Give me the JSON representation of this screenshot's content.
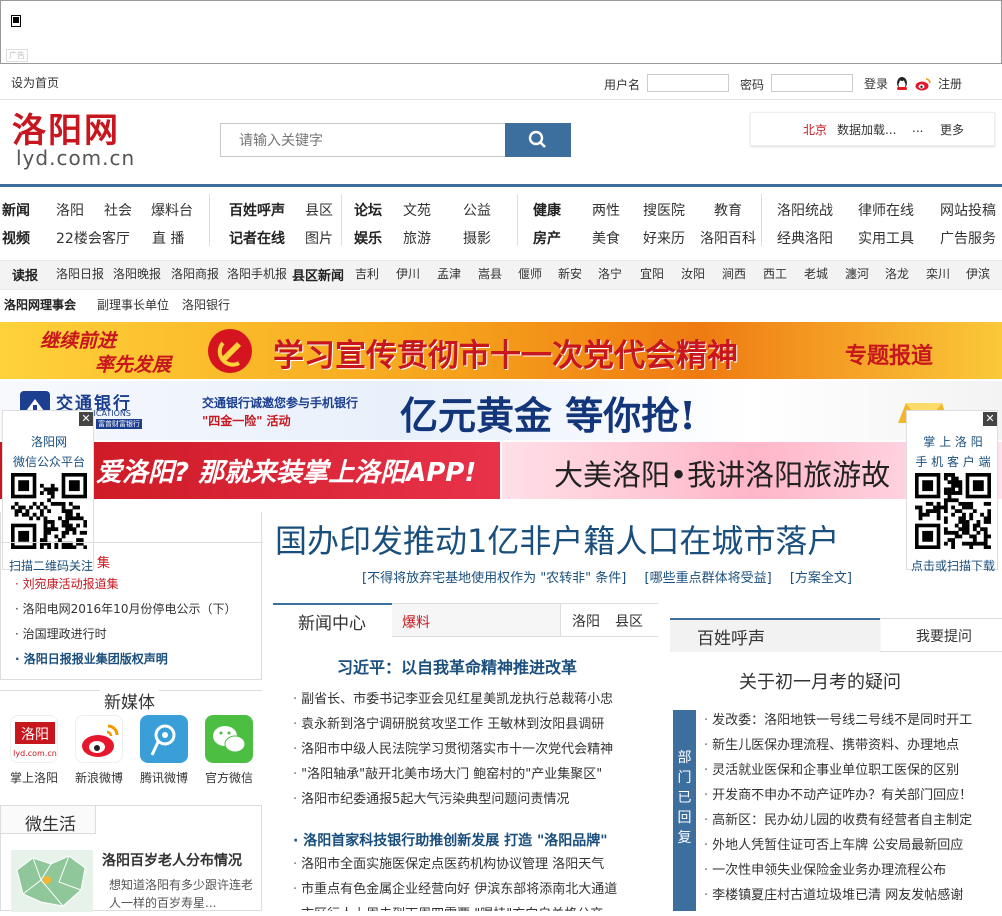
{
  "ad_top": {
    "tag": "广告"
  },
  "topbar": {
    "home_link": "设为首页",
    "username_label": "用户名",
    "password_label": "密码",
    "login": "登录",
    "register": "注册"
  },
  "logo": {
    "main": "洛阳网",
    "sub": "lyd.com.cn"
  },
  "search": {
    "placeholder": "请输入关键字"
  },
  "weather": {
    "city": "北京",
    "status": "数据加载...",
    "dots": "...",
    "more": "更多"
  },
  "nav": {
    "row1": [
      "新闻",
      "洛阳",
      "社会",
      "爆料台",
      "百姓呼声",
      "县区",
      "论坛",
      "文苑",
      "公益",
      "健康",
      "两性",
      "搜医院",
      "教育",
      "洛阳统战",
      "律师在线",
      "网站投稿"
    ],
    "row2": [
      "视频",
      "22楼会客厅",
      "直 播",
      "记者在线",
      "图片",
      "娱乐",
      "旅游",
      "摄影",
      "房产",
      "美食",
      "好来历",
      "洛阳百科",
      "经典洛阳",
      "实用工具",
      "广告服务"
    ],
    "row3": [
      "读报",
      "洛阳日报",
      "洛阳晚报",
      "洛阳商报",
      "洛阳手机报",
      "县区新闻",
      "吉利",
      "伊川",
      "孟津",
      "嵩县",
      "偃师",
      "新安",
      "洛宁",
      "宜阳",
      "汝阳",
      "涧西",
      "西工",
      "老城",
      "瀍河",
      "洛龙",
      "栾川",
      "伊滨"
    ],
    "row4": [
      "洛阳网理事会",
      "副理事长单位",
      "洛阳银行"
    ]
  },
  "banners": {
    "b1_left1": "继续前进",
    "b1_left2": "率先发展",
    "b1_main": "学习宣传贯彻市十一次党代会精神",
    "b1_right": "专题报道",
    "b2_bank": "交通银行",
    "b2_bank_en": "COMMUNICATIONS",
    "b2_bank_small": "富曾财富银行",
    "b2_sub1": "交通银行诚邀您参与手机银行",
    "b2_sub2": "\"四金一险\" 活动",
    "b2_main": "亿元黄金  等你抢!",
    "b3_left": "爱洛阳? 那就来装掌上洛阳APP!",
    "b3_right": "大美洛阳•我讲洛阳旅游故"
  },
  "qr_left": {
    "line1": "洛阳网",
    "line2": "微信公众平台",
    "caption": "扫描二维码关注"
  },
  "qr_right": {
    "line1": "掌 上 洛 阳",
    "line2": "手 机 客 户 端",
    "caption": "点击或扫描下载"
  },
  "left_list": [
    "集",
    "刘宛康活动报道集",
    "洛阳电网2016年10月份停电公示（下）",
    "治国理政进行时",
    "洛阳日报报业集团版权声明"
  ],
  "headline": {
    "main": "国办印发推动1亿非户籍人口在城市落户",
    "sub1": "[不得将放弃宅基地使用权作为 \"农转非\" 条件]",
    "sub2": "[哪些重点群体将受益]",
    "sub3": "[方案全文]"
  },
  "news_center": {
    "tab_active": "新闻中心",
    "tab_red": "爆料",
    "tab_r1": "洛阳",
    "tab_r2": "县区",
    "top_story": "习近平：以自我革命精神推进改革",
    "items1": [
      "副省长、市委书记李亚会见红星美凯龙执行总裁蒋小忠",
      "袁永新到洛宁调研脱贫攻坚工作 王敏林到汝阳县调研",
      "洛阳市中级人民法院学习贯彻落实市十一次党代会精神",
      "\"洛阳轴承\"敲开北美市场大门 鲍窑村的\"产业集聚区\"",
      "洛阳市纪委通报5起大气污染典型问题问责情况"
    ],
    "story2": "洛阳首家科技银行助推创新发展 打造 \"洛阳品牌\"",
    "items2": [
      "洛阳市全面实施医保定点医药机构协议管理 洛阳天气",
      "市重点有色金属企业经营向好 伊滨东部将添南北大通道",
      "市区行人上周未到下周四需要 \"曝挂\"方向自关格公交"
    ]
  },
  "voice": {
    "tab": "百姓呼声",
    "ask": "我要提问",
    "top": "关于初一月考的疑问",
    "side_label": "部门已回复",
    "items": [
      "发改委：洛阳地铁一号线二号线不是同时开工",
      "新生儿医保办理流程、携带资料、办理地点",
      "灵活就业医保和企事业单位职工医保的区别",
      "开发商不申办不动产证咋办？有关部门回应！",
      "高新区：民办幼儿园的收费有经营者自主制定",
      "外地人凭暂住证可否上车牌  公安局最新回应",
      "一次性申领失业保险金业务办理流程公布",
      "李楼镇夏庄村古道垃圾堆已清  网友发帖感谢"
    ]
  },
  "new_media": {
    "title": "新媒体",
    "items": [
      {
        "label": "掌上洛阳",
        "icon": "lyd-app-icon"
      },
      {
        "label": "新浪微博",
        "icon": "sina-weibo-icon"
      },
      {
        "label": "腾讯微博",
        "icon": "tencent-weibo-icon"
      },
      {
        "label": "官方微信",
        "icon": "wechat-icon"
      }
    ]
  },
  "micro_life": {
    "title": "微生活",
    "story_title": "洛阳百岁老人分布情况",
    "story_desc": "想知道洛阳有多少跟许连老人一样的百岁寿星..."
  },
  "colors": {
    "brand_red": "#c8161e",
    "nav_blue": "#3c6e9e",
    "headline_blue": "#1a4f7d"
  }
}
